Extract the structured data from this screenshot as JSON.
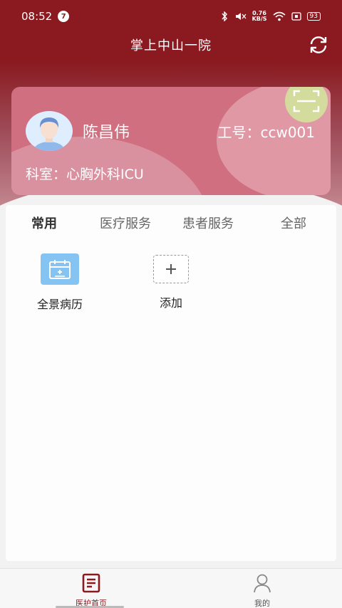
{
  "status_bar": {
    "time": "08:52",
    "notification_count": "7",
    "net_speed_value": "0.76",
    "net_speed_unit": "KB/S",
    "battery": "93"
  },
  "header": {
    "title": "掌上中山一院"
  },
  "user_card": {
    "name": "陈昌伟",
    "staff_id": "工号：ccw001",
    "department": "科室：心胸外科ICU"
  },
  "tabs": [
    {
      "label": "常用",
      "active": true
    },
    {
      "label": "医疗服务",
      "active": false
    },
    {
      "label": "患者服务",
      "active": false
    },
    {
      "label": "全部",
      "active": false
    }
  ],
  "apps": [
    {
      "label": "全景病历",
      "icon": "calendar-record-icon"
    },
    {
      "label": "添加",
      "icon": "plus-icon"
    }
  ],
  "bottom_nav": [
    {
      "label": "医护首页",
      "icon": "document-list-icon",
      "active": true
    },
    {
      "label": "我的",
      "icon": "person-icon",
      "active": false
    }
  ],
  "colors": {
    "brand": "#8a1a20",
    "card": "#cf6f80",
    "app_icon_blue": "#85c3f2",
    "scan_button": "#d3dc9c"
  }
}
